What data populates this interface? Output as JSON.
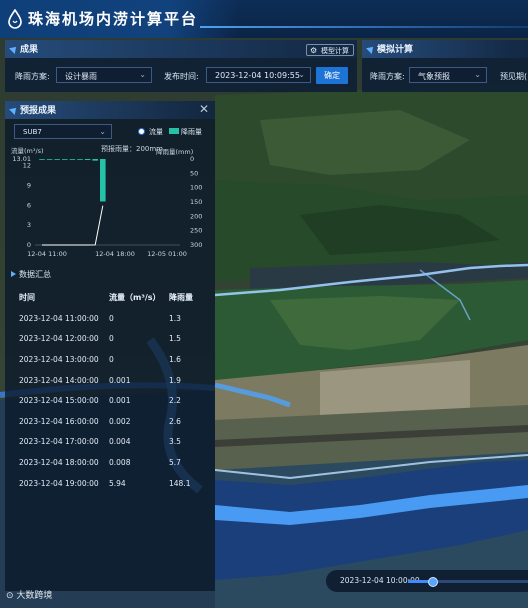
{
  "app": {
    "title": "珠海机场内涝计算平台"
  },
  "results_panel": {
    "title": "成果",
    "model_button": "模型计算",
    "scheme_label": "降雨方案:",
    "scheme_value": "设计暴雨",
    "publish_label": "发布时间:",
    "publish_value": "2023-12-04 10:09:55",
    "confirm_button": "确定"
  },
  "simulation_panel": {
    "title": "模拟计算",
    "scheme_label": "降雨方案:",
    "scheme_value": "气象预报",
    "period_label": "预见期("
  },
  "forecast_panel": {
    "title": "预报成果",
    "subcatchment": "SUB7",
    "legend_flow": "流量",
    "legend_rain": "降雨量",
    "forecast_rain_text": "预报雨量：200mm",
    "summary_title": "数据汇总",
    "columns": [
      "时间",
      "流量（m³/s）",
      "降雨量"
    ],
    "rows": [
      [
        "2023-12-04 11:00:00",
        "0",
        "1.3"
      ],
      [
        "2023-12-04 12:00:00",
        "0",
        "1.5"
      ],
      [
        "2023-12-04 13:00:00",
        "0",
        "1.6"
      ],
      [
        "2023-12-04 14:00:00",
        "0.001",
        "1.9"
      ],
      [
        "2023-12-04 15:00:00",
        "0.001",
        "2.2"
      ],
      [
        "2023-12-04 16:00:00",
        "0.002",
        "2.6"
      ],
      [
        "2023-12-04 17:00:00",
        "0.004",
        "3.5"
      ],
      [
        "2023-12-04 18:00:00",
        "0.008",
        "5.7"
      ],
      [
        "2023-12-04 19:00:00",
        "5.94",
        "148.1"
      ]
    ]
  },
  "chart_data": {
    "type": "bar",
    "left_axis_label": "流量(m³/s)",
    "right_axis_label": "降雨量(mm)",
    "left_ticks": [
      "13.01",
      "12",
      "9",
      "6",
      "3",
      "0"
    ],
    "right_ticks": [
      "0",
      "50",
      "100",
      "150",
      "200",
      "250",
      "300"
    ],
    "x_ticks": [
      "12-04 11:00",
      "12-04 18:00",
      "12-05 01:00"
    ],
    "ylim_left": [
      0,
      13.01
    ],
    "ylim_right": [
      0,
      300
    ],
    "series": [
      {
        "name": "流量",
        "type": "line",
        "values": [
          0,
          0,
          0,
          0.001,
          0.001,
          0.002,
          0.004,
          0.008,
          5.94
        ]
      },
      {
        "name": "降雨量",
        "type": "bar",
        "values": [
          1.3,
          1.5,
          1.6,
          1.9,
          2.2,
          2.6,
          3.5,
          5.7,
          148.1
        ]
      }
    ],
    "categories": [
      "12-04 11:00",
      "12-04 12:00",
      "12-04 13:00",
      "12-04 14:00",
      "12-04 15:00",
      "12-04 16:00",
      "12-04 17:00",
      "12-04 18:00",
      "12-04 19:00"
    ]
  },
  "timeline": {
    "time": "2023-12-04 10:00:00",
    "progress": 0.2
  },
  "watermark": "大数跨境",
  "colors": {
    "accent": "#1e74d6",
    "rain_bar": "#26c2a8",
    "header": "#0d2d55"
  }
}
